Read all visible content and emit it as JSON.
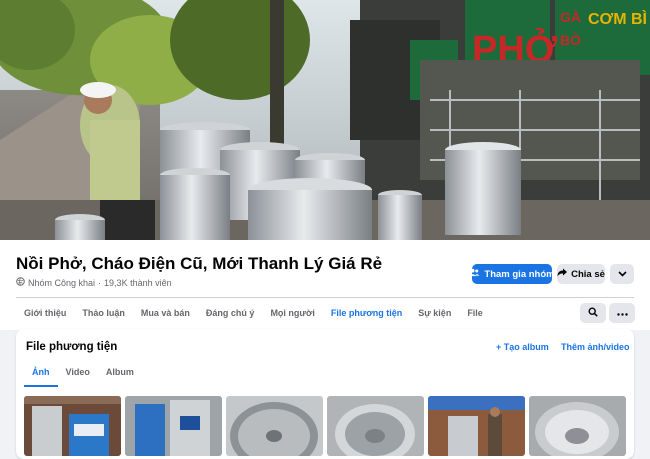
{
  "cover": {
    "signs": [
      {
        "text": "PHỞ",
        "color": "#c62828"
      },
      {
        "text": "GÀ",
        "color": "#c62828"
      },
      {
        "text": "BÒ",
        "color": "#c62828"
      },
      {
        "text": "CƠM BÌ",
        "color": "#e8b400"
      }
    ]
  },
  "group": {
    "name": "Nồi Phở, Cháo Điện Cũ, Mới Thanh Lý Giá Rẻ",
    "privacy": "Nhóm Công khai",
    "separator": "·",
    "members": "19,3K thành viên",
    "privacy_icon": "globe-icon"
  },
  "actions": {
    "join_label": "Tham gia nhóm",
    "join_icon": "group-icon",
    "share_label": "Chia sẻ",
    "share_icon": "share-arrow-icon",
    "more_icon": "chevron-down-icon"
  },
  "tabs": [
    {
      "label": "Giới thiệu"
    },
    {
      "label": "Thảo luận"
    },
    {
      "label": "Mua và bán"
    },
    {
      "label": "Đáng chú ý"
    },
    {
      "label": "Mọi người"
    },
    {
      "label": "File phương tiện",
      "active": true
    },
    {
      "label": "Sự kiện"
    },
    {
      "label": "File"
    }
  ],
  "tab_icons": {
    "search": "search-icon",
    "more": "ellipsis-icon"
  },
  "media": {
    "title": "File phương tiện",
    "create_album": "+ Tạo album",
    "add_media": "Thêm ảnh/video",
    "subtabs": [
      {
        "label": "Ảnh",
        "active": true
      },
      {
        "label": "Video"
      },
      {
        "label": "Album"
      }
    ]
  },
  "colors": {
    "accent": "#1b74e4",
    "background": "#f0f2f5",
    "secondary_button": "#e4e6eb"
  }
}
